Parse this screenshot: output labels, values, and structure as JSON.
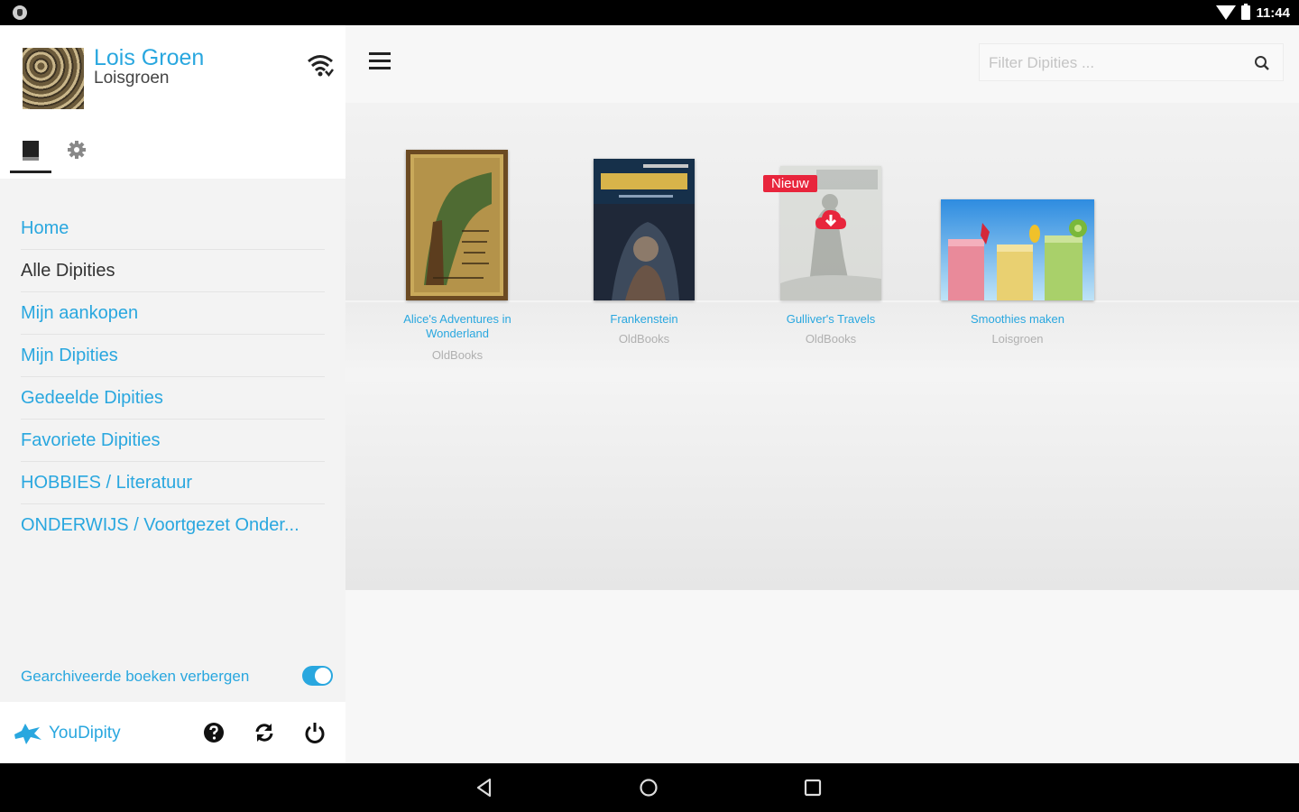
{
  "status_bar": {
    "time": "11:44"
  },
  "sidebar": {
    "user": {
      "name": "Lois Groen",
      "handle": "Loisgroen"
    },
    "menu": [
      {
        "label": "Home"
      },
      {
        "label": "Alle Dipities"
      },
      {
        "label": "Mijn aankopen"
      },
      {
        "label": "Mijn Dipities"
      },
      {
        "label": "Gedeelde Dipities"
      },
      {
        "label": "Favoriete Dipities"
      },
      {
        "label": "HOBBIES / Literatuur"
      },
      {
        "label": "ONDERWIJS / Voortgezet Onder..."
      }
    ],
    "active_menu": "Alle Dipities",
    "archive_toggle": {
      "label": "Gearchiveerde boeken verbergen",
      "on": true
    },
    "brand": "YouDipity"
  },
  "main": {
    "search": {
      "placeholder": "Filter Dipities ...",
      "value": ""
    },
    "books": [
      {
        "title": "Alice's Adventures in Wonderland",
        "author": "OldBooks",
        "badge": ""
      },
      {
        "title": "Frankenstein",
        "author": "OldBooks",
        "badge": ""
      },
      {
        "title": "Gulliver's Travels",
        "author": "OldBooks",
        "badge": "Nieuw"
      },
      {
        "title": "Smoothies maken",
        "author": "Loisgroen",
        "badge": ""
      }
    ]
  },
  "colors": {
    "accent": "#29a7df",
    "badge": "#e8253c",
    "text": "#333333"
  },
  "icons": [
    "wifi-icon",
    "book-icon",
    "gear-icon",
    "menu-icon",
    "search-icon",
    "cloud-download-icon",
    "help-icon",
    "sync-icon",
    "power-icon",
    "back-icon",
    "home-icon",
    "recents-icon"
  ]
}
